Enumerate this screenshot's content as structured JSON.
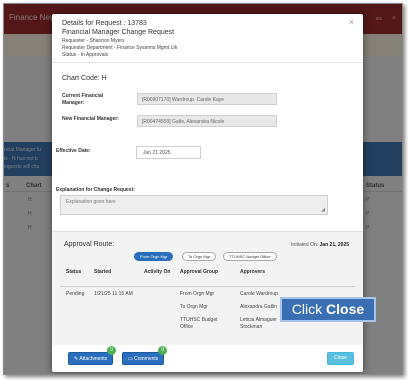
{
  "background": {
    "app_title": "Finance New",
    "user_text": "ais",
    "close_glyph": "×",
    "blue_lines": [
      "ncial Manager fu",
      "ls - N has not b",
      "equests will cha"
    ],
    "columns": [
      "s",
      "Chart",
      "Status",
      "Status"
    ],
    "rows": [
      {
        "chart": "H",
        "status": "P"
      },
      {
        "chart": "H",
        "status": "P"
      },
      {
        "chart": "H",
        "status": "P"
      }
    ]
  },
  "modal": {
    "title": "Details for Request : 13783",
    "subtitle": "Financial Manager Change Request",
    "requester": "Requester - Shannon Myers",
    "department": "Requester Department - Finance Systems Mgmt Ltk",
    "status": "Status - In Approvals",
    "close_glyph": "×",
    "chart_code": "Chart Code: H",
    "current_fm_label": "Current Financial Manager:",
    "current_fm_value": "[R00907170] Wardroup, Carole Kaye",
    "new_fm_label": "New Financial Manager:",
    "new_fm_value": "[R00474559] Gatle, Alexandra Nicole",
    "effective_label": "Effective Date:",
    "effective_value": "Jan 21 2025",
    "explanation_label": "Explanation for Change Request:",
    "explanation_value": "Explanation goes here"
  },
  "route": {
    "title": "Approval Route:",
    "initiated_prefix": "Initiated On:",
    "initiated_date": "Jan 21, 2025",
    "pills": [
      "From Orgn Mgr",
      "To Orgn Mgr",
      "TTUHSC Budget Office"
    ],
    "headers": [
      "Status",
      "Started",
      "Activity On",
      "Approval Group",
      "Approvers"
    ],
    "rows": [
      {
        "status": "Pending",
        "started": "1/21/25 11:15 AM",
        "activity": "",
        "group": "From Orgn Mgr",
        "approvers": "Carole Wardroup"
      },
      {
        "status": "",
        "started": "",
        "activity": "",
        "group": "To Orgn Mgr",
        "approvers": "Alexandra Gatlin"
      },
      {
        "status": "",
        "started": "",
        "activity": "",
        "group": "TTUHSC Budget Office",
        "approvers": "Leticia Almaguer Stockman"
      }
    ]
  },
  "callout": {
    "prefix": "Click",
    "target": "Close"
  },
  "footer": {
    "attachments_label": "Attachments",
    "attachments_count": "0",
    "comments_label": "Comments",
    "comments_count": "0",
    "close_label": "Close"
  },
  "colors": {
    "primary_button": "#2a6ebd",
    "close_button": "#5bc0de",
    "header_bar": "#9a2a2a",
    "callout": "#3b6fb3"
  },
  "icons": [
    "paperclip-icon",
    "comment-icon",
    "close-icon"
  ]
}
